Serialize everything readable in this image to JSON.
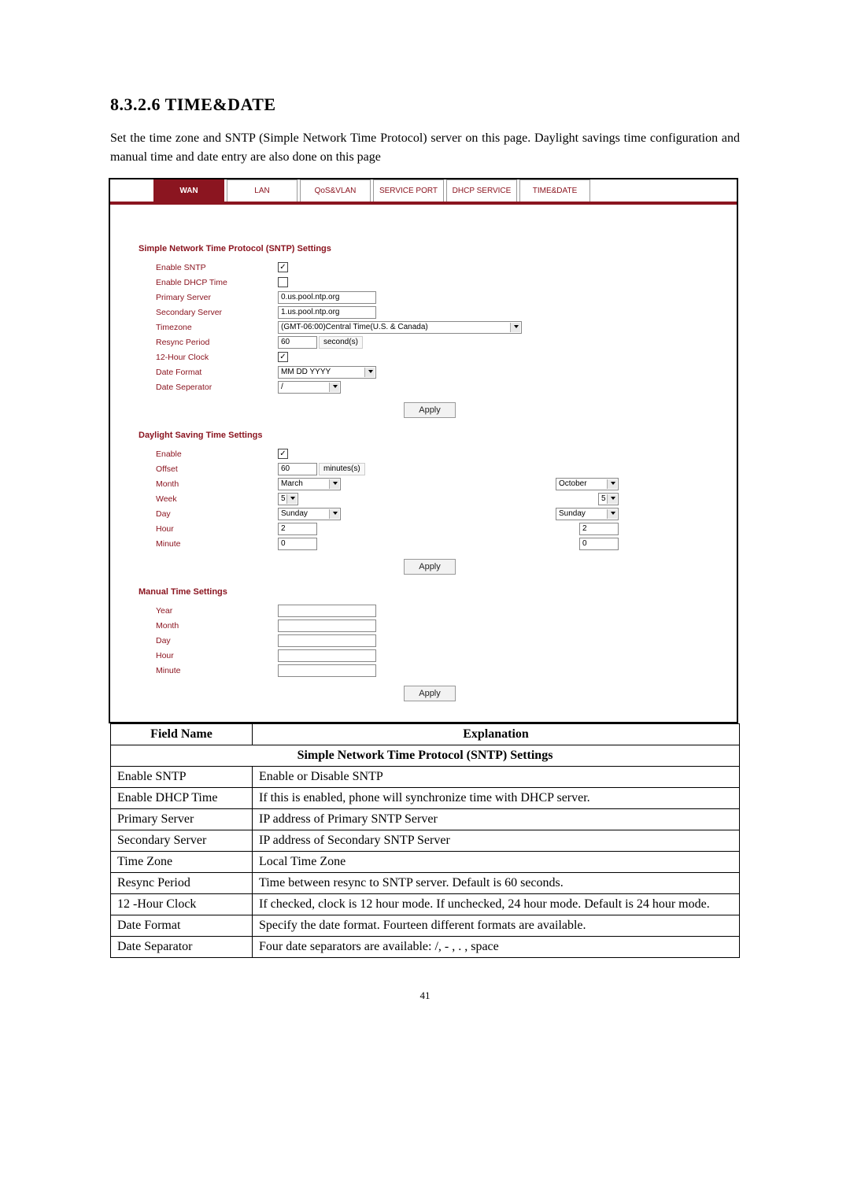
{
  "heading": "8.3.2.6   TIME&DATE",
  "intro": "Set the time zone and SNTP (Simple Network Time Protocol) server on this page.    Daylight savings time configuration and manual time and date entry are also done on this page",
  "tabs": {
    "wan": "WAN",
    "lan": "LAN",
    "qosvlan": "QoS&VLAN",
    "service_port": "SERVICE PORT",
    "dhcp_service": "DHCP SERVICE",
    "time_date": "TIME&DATE"
  },
  "sntp": {
    "section_title": "Simple Network Time Protocol (SNTP) Settings",
    "enable_sntp_label": "Enable SNTP",
    "enable_sntp_checked": "✓",
    "enable_dhcp_label": "Enable DHCP Time",
    "enable_dhcp_checked": "",
    "primary_label": "Primary Server",
    "primary_value": "0.us.pool.ntp.org",
    "secondary_label": "Secondary Server",
    "secondary_value": "1.us.pool.ntp.org",
    "timezone_label": "Timezone",
    "timezone_value": "(GMT-06:00)Central Time(U.S. & Canada)",
    "resync_label": "Resync Period",
    "resync_value": "60",
    "resync_unit": "second(s)",
    "clock12_label": "12-Hour Clock",
    "clock12_checked": "✓",
    "dateformat_label": "Date Format",
    "dateformat_value": "MM DD YYYY",
    "datesep_label": "Date Seperator",
    "datesep_value": "/",
    "apply": "Apply"
  },
  "dst": {
    "section_title": "Daylight Saving Time Settings",
    "enable_label": "Enable",
    "enable_checked": "✓",
    "offset_label": "Offset",
    "offset_value": "60",
    "offset_unit": "minutes(s)",
    "month_label": "Month",
    "month_start": "March",
    "month_end": "October",
    "week_label": "Week",
    "week_start": "5",
    "week_end": "5",
    "day_label": "Day",
    "day_start": "Sunday",
    "day_end": "Sunday",
    "hour_label": "Hour",
    "hour_start": "2",
    "hour_end": "2",
    "minute_label": "Minute",
    "minute_start": "0",
    "minute_end": "0",
    "apply": "Apply"
  },
  "manual": {
    "section_title": "Manual Time Settings",
    "year_label": "Year",
    "month_label": "Month",
    "day_label": "Day",
    "hour_label": "Hour",
    "minute_label": "Minute",
    "apply": "Apply"
  },
  "table": {
    "header_field": "Field Name",
    "header_expl": "Explanation",
    "section1": "Simple Network Time Protocol (SNTP) Settings",
    "rows": [
      {
        "f": "Enable SNTP",
        "e": "Enable or Disable SNTP"
      },
      {
        "f": "Enable DHCP Time",
        "e": "If this is enabled, phone will synchronize time with DHCP server."
      },
      {
        "f": "Primary Server",
        "e": "IP address of Primary SNTP Server"
      },
      {
        "f": "Secondary Server",
        "e": "IP address of Secondary SNTP Server"
      },
      {
        "f": "Time Zone",
        "e": "Local Time Zone"
      },
      {
        "f": "Resync Period",
        "e": "Time between resync to SNTP server. Default is 60 seconds."
      },
      {
        "f": "12 -Hour Clock",
        "e": "If checked, clock is 12 hour mode. If unchecked, 24 hour mode. Default is 24 hour mode."
      },
      {
        "f": "Date Format",
        "e": "Specify the date format. Fourteen different formats are available."
      },
      {
        "f": "Date Separator",
        "e": "Four date separators are available: /, - , . , space"
      }
    ]
  },
  "page_number": "41"
}
